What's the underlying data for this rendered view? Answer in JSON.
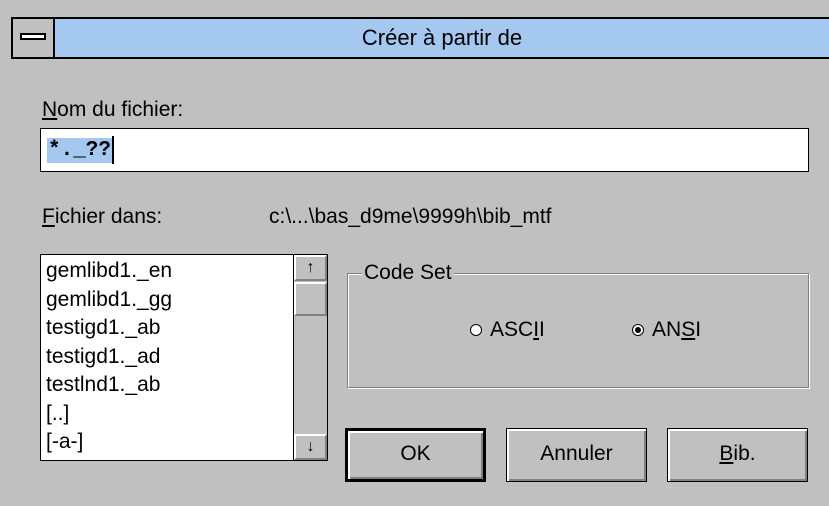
{
  "window": {
    "title": "Créer à partir de"
  },
  "filename": {
    "label_accel": "N",
    "label_rest": "om du fichier:",
    "value": "*._??"
  },
  "directory": {
    "label_accel": "F",
    "label_rest": "ichier dans:",
    "path": "c:\\...\\bas_d9me\\9999h\\bib_mtf"
  },
  "files": {
    "items": [
      "gemlibd1._en",
      "gemlibd1._gg",
      "testigd1._ab",
      "testigd1._ad",
      "testlnd1._ab",
      "[..]",
      "[-a-]"
    ],
    "scroll_up": "↑",
    "scroll_down": "↓"
  },
  "codeset": {
    "title": "Code Set",
    "options": [
      {
        "pre": "ASC",
        "accel": "I",
        "post": "I",
        "checked": false
      },
      {
        "pre": "AN",
        "accel": "S",
        "post": "I",
        "checked": true
      }
    ]
  },
  "buttons": {
    "ok": "OK",
    "cancel": "Annuler",
    "bib_accel": "B",
    "bib_rest": "ib."
  },
  "colors": {
    "dialog_bg": "#c0c0c0",
    "title_bar": "#a4c8f0",
    "selection": "#a4c8f0"
  }
}
